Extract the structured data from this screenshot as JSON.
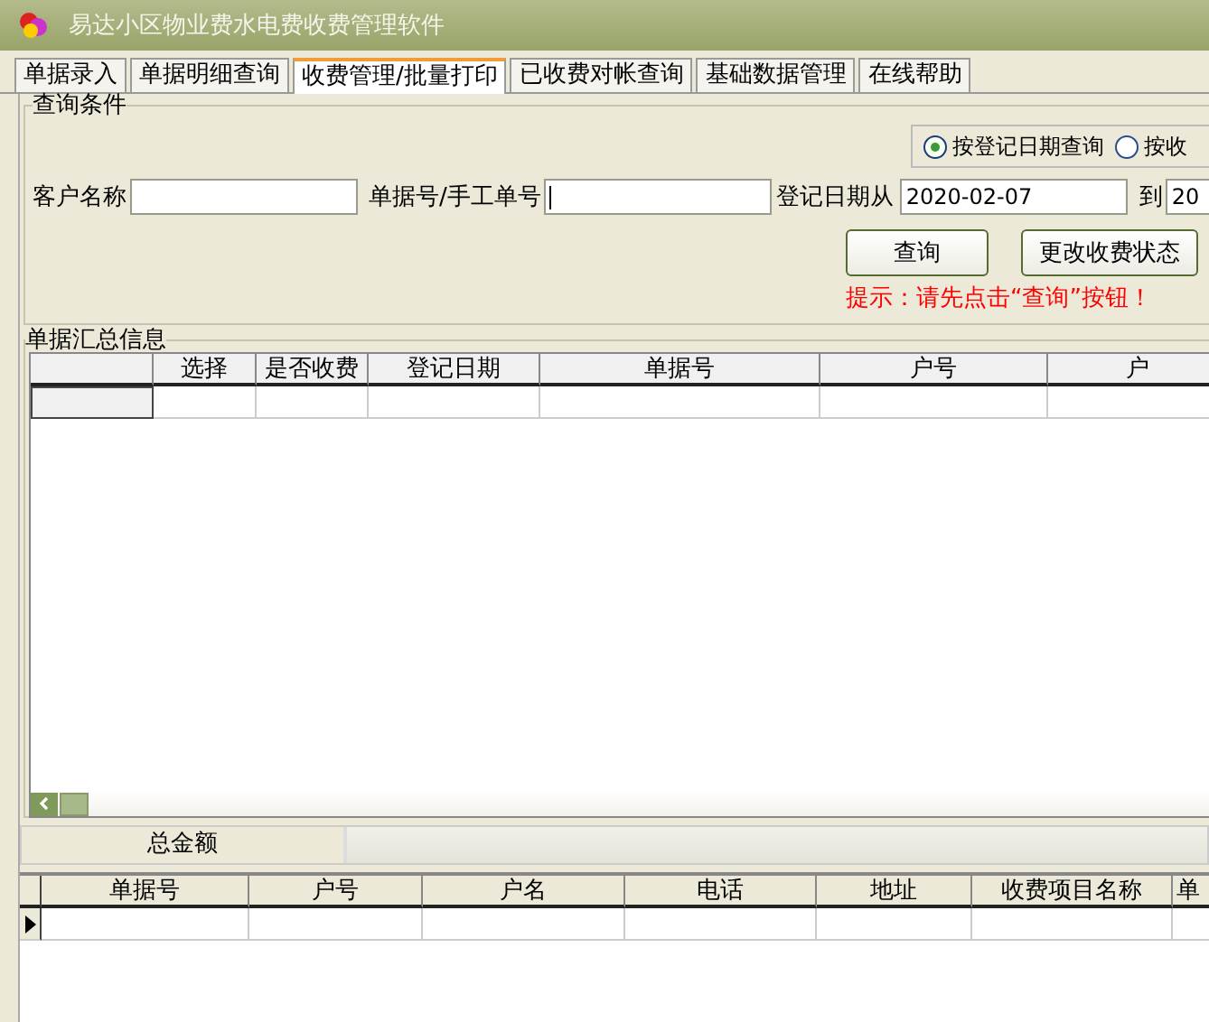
{
  "window": {
    "title": "易达小区物业费水电费收费管理软件"
  },
  "tabs": [
    {
      "label": "单据录入",
      "selected": false
    },
    {
      "label": "单据明细查询",
      "selected": false
    },
    {
      "label": "收费管理/批量打印",
      "selected": true
    },
    {
      "label": "已收费对帐查询",
      "selected": false
    },
    {
      "label": "基础数据管理",
      "selected": false
    },
    {
      "label": "在线帮助",
      "selected": false
    }
  ],
  "query": {
    "title": "查询条件",
    "radios": [
      {
        "label": "按登记日期查询",
        "selected": true
      },
      {
        "label": "按收",
        "selected": false
      }
    ],
    "customer_label": "客户名称",
    "bill_label": "单据号/手工单号",
    "date_from_label": "登记日期从",
    "date_from": "2020-02-07",
    "date_to_label": "到",
    "date_to": "20",
    "buttons": [
      "查询",
      "更改收费状态"
    ],
    "hint": "提示：请先点击“查询”按钮！"
  },
  "summary": {
    "title": "单据汇总信息",
    "columns": [
      "选择",
      "是否收费",
      "登记日期",
      "单据号",
      "户号",
      "户"
    ]
  },
  "total_label": "总金额",
  "detail": {
    "columns": [
      "单据号",
      "户号",
      "户名",
      "电话",
      "地址",
      "收费项目名称",
      "单"
    ]
  }
}
